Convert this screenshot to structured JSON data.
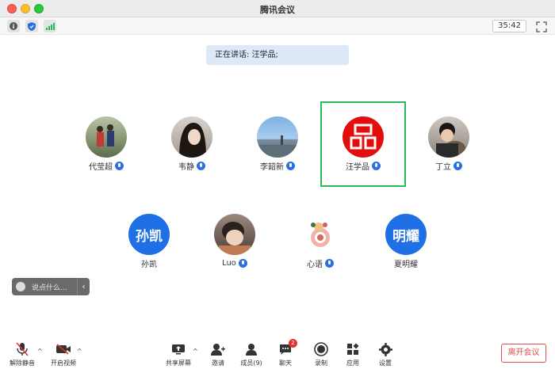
{
  "window": {
    "title": "腾讯会议"
  },
  "toolbar": {
    "timer": "35:42"
  },
  "speaking_banner": "正在讲话: 汪学品;",
  "participants_row1": [
    {
      "name": "代莹超",
      "icon": "mic-icon"
    },
    {
      "name": "韦静",
      "icon": "mic-icon"
    },
    {
      "name": "李韶新",
      "icon": "mic-icon"
    },
    {
      "name": "汪学品",
      "icon": "mic-icon",
      "avatar_text": "品"
    },
    {
      "name": "丁立",
      "icon": "mic-icon"
    }
  ],
  "participants_row2": [
    {
      "name": "孙凯",
      "avatar_text": "孙凯"
    },
    {
      "name": "Luo",
      "icon": "mic-icon"
    },
    {
      "name": "心语",
      "icon": "mic-icon"
    },
    {
      "name": "夏明耀",
      "avatar_text": "明耀"
    }
  ],
  "chat": {
    "placeholder": "说点什么..."
  },
  "bottom": {
    "unmute": "解除静音",
    "start_video": "开启视频",
    "share_screen": "共享屏幕",
    "invite": "邀请",
    "members": "成员(9)",
    "chat": "聊天",
    "chat_badge": "2",
    "record": "录制",
    "apps": "应用",
    "settings": "设置",
    "leave": "离开会议"
  },
  "colors": {
    "accent": "#1f6fe6",
    "active_border": "#2eb85c",
    "leave": "#e14b4b"
  }
}
